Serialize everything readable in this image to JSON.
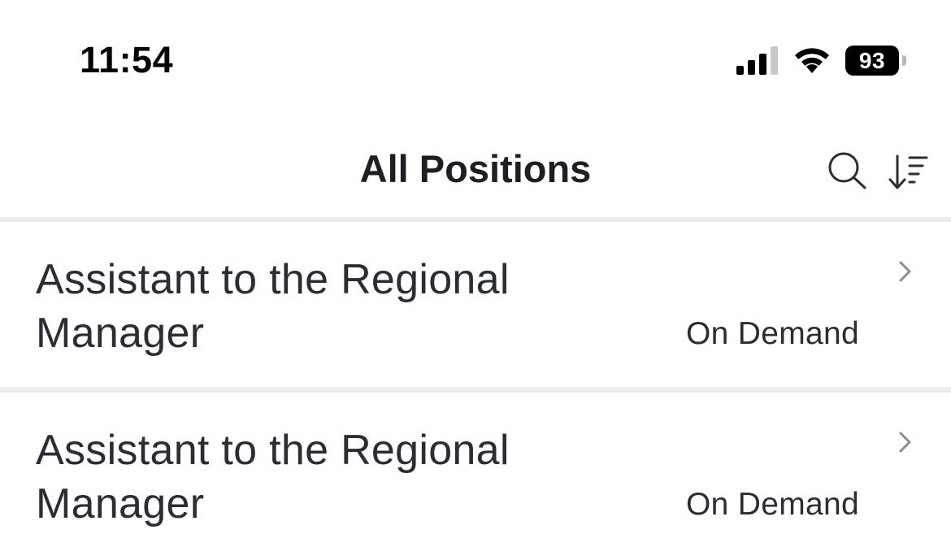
{
  "status_bar": {
    "time": "11:54",
    "battery_level": "93",
    "signal_bars": 3,
    "signal_bars_total": 4
  },
  "nav": {
    "title": "All Positions",
    "search_icon": "search-icon",
    "sort_icon": "sort-descending-icon"
  },
  "positions": [
    {
      "title": "Assistant to the Regional Manager",
      "type": "On Demand"
    },
    {
      "title": "Assistant to the Regional Manager",
      "type": "On Demand"
    }
  ],
  "colors": {
    "text": "#2b2d36",
    "divider": "#ebebed",
    "chevron": "#8a8b93"
  }
}
